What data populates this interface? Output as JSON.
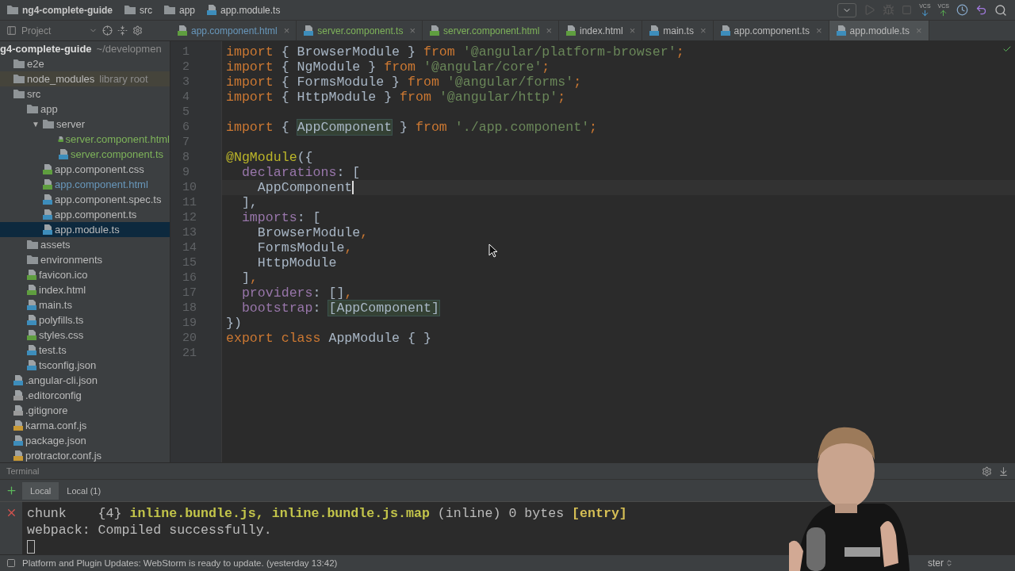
{
  "breadcrumbs": [
    {
      "label": "ng4-complete-guide",
      "kind": "folder"
    },
    {
      "label": "src",
      "kind": "folder"
    },
    {
      "label": "app",
      "kind": "folder"
    },
    {
      "label": "app.module.ts",
      "kind": "ts"
    }
  ],
  "vcs_buttons": [
    {
      "label": "VCS",
      "kind": "update"
    },
    {
      "label": "VCS",
      "kind": "commit"
    }
  ],
  "project_panel": {
    "selector": "Project",
    "root": {
      "label": "g4-complete-guide",
      "path": "~/developmen"
    },
    "items": [
      {
        "label": "e2e",
        "kind": "folder"
      },
      {
        "label": "node_modules",
        "kind": "folder",
        "hint": "library root"
      },
      {
        "label": "src",
        "kind": "folder",
        "children": [
          {
            "label": "app",
            "kind": "folder",
            "children": [
              {
                "label": "server",
                "kind": "folder",
                "toggle": "▼",
                "children": [
                  {
                    "label": "server.component.html",
                    "kind": "html",
                    "color": "#7eb35a",
                    "selected": false
                  },
                  {
                    "label": "server.component.ts",
                    "kind": "ts",
                    "color": "#7eb35a",
                    "selected": false
                  }
                ]
              },
              {
                "label": "app.component.css",
                "kind": "css",
                "color": "#bbbbbb",
                "selected": false
              },
              {
                "label": "app.component.html",
                "kind": "html",
                "color": "#6897bb",
                "selected": false
              },
              {
                "label": "app.component.spec.ts",
                "kind": "ts",
                "color": "#bbbbbb",
                "selected": false
              },
              {
                "label": "app.component.ts",
                "kind": "ts",
                "color": "#bbbbbb",
                "selected": false
              },
              {
                "label": "app.module.ts",
                "kind": "ts",
                "color": "#bbbbbb",
                "selected": true
              }
            ]
          },
          {
            "label": "assets",
            "kind": "folder"
          },
          {
            "label": "environments",
            "kind": "folder"
          },
          {
            "label": "favicon.ico",
            "kind": "ico",
            "color": "#bbbbbb",
            "selected": false
          },
          {
            "label": "index.html",
            "kind": "html",
            "color": "#bbbbbb",
            "selected": false
          },
          {
            "label": "main.ts",
            "kind": "ts",
            "color": "#bbbbbb",
            "selected": false
          },
          {
            "label": "polyfills.ts",
            "kind": "ts",
            "color": "#bbbbbb",
            "selected": false
          },
          {
            "label": "styles.css",
            "kind": "css",
            "color": "#bbbbbb",
            "selected": false
          },
          {
            "label": "test.ts",
            "kind": "ts",
            "color": "#bbbbbb",
            "selected": false
          },
          {
            "label": "tsconfig.json",
            "kind": "json",
            "color": "#bbbbbb",
            "selected": false
          }
        ]
      },
      {
        "label": ".angular-cli.json",
        "kind": "json",
        "color": "#bbbbbb",
        "selected": false
      },
      {
        "label": ".editorconfig",
        "kind": "config",
        "color": "#bbbbbb",
        "selected": false
      },
      {
        "label": ".gitignore",
        "kind": "config",
        "color": "#bbbbbb",
        "selected": false
      },
      {
        "label": "karma.conf.js",
        "kind": "js",
        "color": "#bbbbbb",
        "selected": false
      },
      {
        "label": "package.json",
        "kind": "json",
        "color": "#bbbbbb",
        "selected": false
      },
      {
        "label": "protractor.conf.js",
        "kind": "js",
        "color": "#bbbbbb",
        "selected": false
      }
    ]
  },
  "tabs": [
    {
      "label": "app.component.html",
      "kind": "html",
      "color": "#6897bb",
      "selected": false
    },
    {
      "label": "server.component.ts",
      "kind": "ts",
      "color": "#7eb35a",
      "selected": false
    },
    {
      "label": "server.component.html",
      "kind": "html",
      "color": "#7eb35a",
      "selected": false
    },
    {
      "label": "index.html",
      "kind": "html",
      "color": "#bbbbbb",
      "selected": false
    },
    {
      "label": "main.ts",
      "kind": "ts",
      "color": "#bbbbbb",
      "selected": false
    },
    {
      "label": "app.component.ts",
      "kind": "ts",
      "color": "#bbbbbb",
      "selected": false
    },
    {
      "label": "app.module.ts",
      "kind": "ts",
      "color": "#bbbbbb",
      "selected": true
    }
  ],
  "close_mark": "×",
  "code": [
    {
      "n": "1",
      "current": false,
      "tokens": [
        {
          "text": "import",
          "kind": "keyword"
        },
        {
          "text": " { BrowserModule } ",
          "kind": "plain"
        },
        {
          "text": "from",
          "kind": "keyword"
        },
        {
          "text": " '@angular/platform-browser'",
          "kind": "string"
        },
        {
          "text": ";",
          "kind": "keyword"
        }
      ]
    },
    {
      "n": "2",
      "current": false,
      "tokens": [
        {
          "text": "import",
          "kind": "keyword"
        },
        {
          "text": " { NgModule } ",
          "kind": "plain"
        },
        {
          "text": "from",
          "kind": "keyword"
        },
        {
          "text": " '@angular/core'",
          "kind": "string"
        },
        {
          "text": ";",
          "kind": "keyword"
        }
      ]
    },
    {
      "n": "3",
      "current": false,
      "tokens": [
        {
          "text": "import",
          "kind": "keyword"
        },
        {
          "text": " { FormsModule } ",
          "kind": "plain"
        },
        {
          "text": "from",
          "kind": "keyword"
        },
        {
          "text": " '@angular/forms'",
          "kind": "string"
        },
        {
          "text": ";",
          "kind": "keyword"
        }
      ]
    },
    {
      "n": "4",
      "current": false,
      "tokens": [
        {
          "text": "import",
          "kind": "keyword"
        },
        {
          "text": " { HttpModule } ",
          "kind": "plain"
        },
        {
          "text": "from",
          "kind": "keyword"
        },
        {
          "text": " '@angular/http'",
          "kind": "string"
        },
        {
          "text": ";",
          "kind": "keyword"
        }
      ]
    },
    {
      "n": "5",
      "current": false
    },
    {
      "n": "6",
      "current": false,
      "tokens": [
        {
          "text": "import",
          "kind": "keyword"
        },
        {
          "text": " { ",
          "kind": "plain"
        },
        {
          "text": "AppComponent",
          "kind": "usage"
        },
        {
          "text": " } ",
          "kind": "plain"
        },
        {
          "text": "from",
          "kind": "keyword"
        },
        {
          "text": " './app.component'",
          "kind": "string"
        },
        {
          "text": ";",
          "kind": "keyword"
        }
      ]
    },
    {
      "n": "7",
      "current": false
    },
    {
      "n": "8",
      "current": false,
      "tokens": [
        {
          "text": "@NgModule",
          "kind": "decorator"
        },
        {
          "text": "({",
          "kind": "plain"
        }
      ]
    },
    {
      "n": "9",
      "current": false,
      "tokens": [
        {
          "text": "  declarations",
          "kind": "property"
        },
        {
          "text": ": [",
          "kind": "plain"
        }
      ]
    },
    {
      "n": "10",
      "current": true,
      "tokens": [
        {
          "text": "    AppComponent",
          "kind": "plain"
        }
      ]
    },
    {
      "n": "11",
      "current": false,
      "tokens": [
        {
          "text": "  ],",
          "kind": "plain"
        }
      ]
    },
    {
      "n": "12",
      "current": false,
      "tokens": [
        {
          "text": "  imports",
          "kind": "property"
        },
        {
          "text": ": [",
          "kind": "plain"
        }
      ]
    },
    {
      "n": "13",
      "current": false,
      "tokens": [
        {
          "text": "    BrowserModule",
          "kind": "plain"
        },
        {
          "text": ",",
          "kind": "keyword"
        }
      ]
    },
    {
      "n": "14",
      "current": false,
      "tokens": [
        {
          "text": "    FormsModule",
          "kind": "plain"
        },
        {
          "text": ",",
          "kind": "keyword"
        }
      ]
    },
    {
      "n": "15",
      "current": false,
      "tokens": [
        {
          "text": "    HttpModule",
          "kind": "plain"
        }
      ]
    },
    {
      "n": "16",
      "current": false,
      "tokens": [
        {
          "text": "  ]",
          "kind": "plain"
        },
        {
          "text": ",",
          "kind": "keyword"
        }
      ]
    },
    {
      "n": "17",
      "current": false,
      "tokens": [
        {
          "text": "  providers",
          "kind": "property"
        },
        {
          "text": ": []",
          "kind": "plain"
        },
        {
          "text": ",",
          "kind": "keyword"
        }
      ]
    },
    {
      "n": "18",
      "current": false,
      "tokens": [
        {
          "text": "  bootstrap",
          "kind": "property"
        },
        {
          "text": ": ",
          "kind": "plain"
        },
        {
          "text": "[AppComponent]",
          "kind": "usage"
        }
      ]
    },
    {
      "n": "19",
      "current": false,
      "tokens": [
        {
          "text": "})",
          "kind": "plain"
        }
      ]
    },
    {
      "n": "20",
      "current": false,
      "tokens": [
        {
          "text": "export class",
          "kind": "keyword"
        },
        {
          "text": " AppModule { }",
          "kind": "plain"
        }
      ]
    },
    {
      "n": "21",
      "current": false
    }
  ],
  "terminal": {
    "title": "Terminal",
    "tabs": [
      {
        "label": "Local",
        "selected": true
      },
      {
        "label": "Local (1)",
        "selected": false
      }
    ],
    "lines": [
      {
        "tokens": [
          {
            "text": "chunk    {4} ",
            "kind": "plain"
          },
          {
            "text": "inline.bundle.js, inline.bundle.js.map",
            "kind": "file"
          },
          {
            "text": " (inline) 0 bytes ",
            "kind": "plain"
          },
          {
            "text": "[entry]",
            "kind": "entry"
          }
        ]
      },
      {
        "tokens": [
          {
            "text": "webpack: Compiled successfully.",
            "kind": "plain"
          }
        ]
      }
    ]
  },
  "status_bar": {
    "message": "Platform and Plugin Updates: WebStorm is ready to update. (yesterday 13:42)",
    "branch": "ster"
  }
}
